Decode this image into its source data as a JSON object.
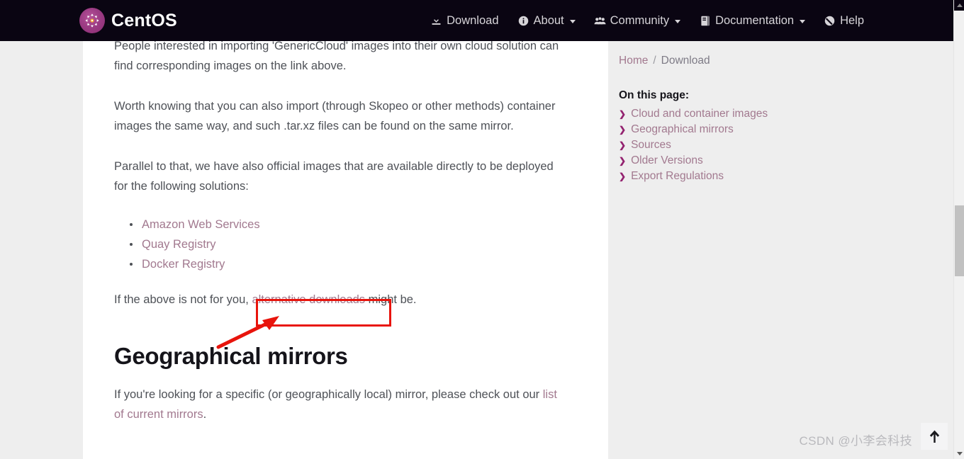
{
  "navbar": {
    "brand": "CentOS",
    "brand_logo_icon": "centos-flower-logo",
    "items": [
      {
        "label": "Download",
        "icon": "download-icon",
        "has_caret": false
      },
      {
        "label": "About",
        "icon": "info-circle-icon",
        "has_caret": true
      },
      {
        "label": "Community",
        "icon": "users-group-icon",
        "has_caret": true
      },
      {
        "label": "Documentation",
        "icon": "book-icon",
        "has_caret": true
      },
      {
        "label": "Help",
        "icon": "help-circle-icon",
        "has_caret": false
      }
    ]
  },
  "main": {
    "paragraphs": {
      "p0": "People interested in importing 'GenericCloud' images into their own cloud solution can find corresponding images on the link above.",
      "p1": "Worth knowing that you can also import (through Skopeo or other methods) container images the same way, and such .tar.xz files can be found on the same mirror.",
      "p2": "Parallel to that, we have also official images that are available directly to be deployed for the following solutions:"
    },
    "solution_links": [
      "Amazon Web Services",
      "Quay Registry",
      "Docker Registry"
    ],
    "alt_sentence": {
      "before": "If the above is not for you, ",
      "link": "alternative downloads",
      "after": " might be."
    },
    "heading": "Geographical mirrors",
    "mirror_sentence": {
      "before": "If you're looking for a specific (or geographically local) mirror, please check out our ",
      "link": "list of current mirrors",
      "after": "."
    }
  },
  "sidebar": {
    "breadcrumb": {
      "home": "Home",
      "separator": "/",
      "current": "Download"
    },
    "on_this_page_title": "On this page:",
    "on_this_page_items": [
      "Cloud and container images",
      "Geographical mirrors",
      "Sources",
      "Older Versions",
      "Export Regulations"
    ]
  },
  "overlay": {
    "annotation_box_color": "#e8140c",
    "annotation_arrow_color": "#e8140c",
    "watermark": "CSDN @小李会科技",
    "scroll_top_icon": "arrow-up-icon"
  },
  "colors": {
    "navbar_bg": "#0a0512",
    "link": "#a2798f",
    "chevron": "#93226f",
    "text": "#4e5157",
    "heading": "#15141a",
    "page_bg": "#eeeeee",
    "content_bg": "#ffffff"
  }
}
